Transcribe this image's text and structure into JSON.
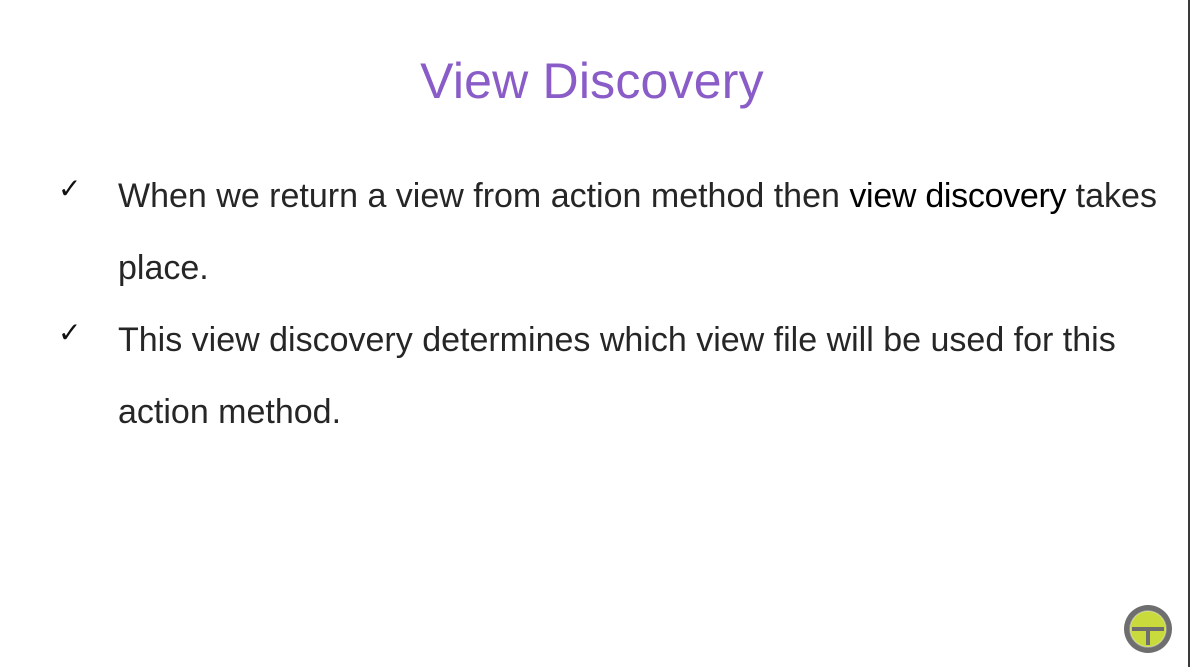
{
  "slide": {
    "title": "View Discovery",
    "bullets": [
      {
        "icon": "check-icon",
        "text_before": "When we return a view from action method then ",
        "text_emphasis": "view discovery",
        "text_after": " takes place."
      },
      {
        "icon": "check-icon",
        "text": "This view discovery determines which view file will be used for this action method."
      }
    ],
    "logo_icon": "g-logo-icon",
    "colors": {
      "title": "#8a5cc8",
      "body_text": "#262626",
      "logo_ring": "#6e6e6e",
      "logo_fill": "#c9db3c"
    }
  }
}
